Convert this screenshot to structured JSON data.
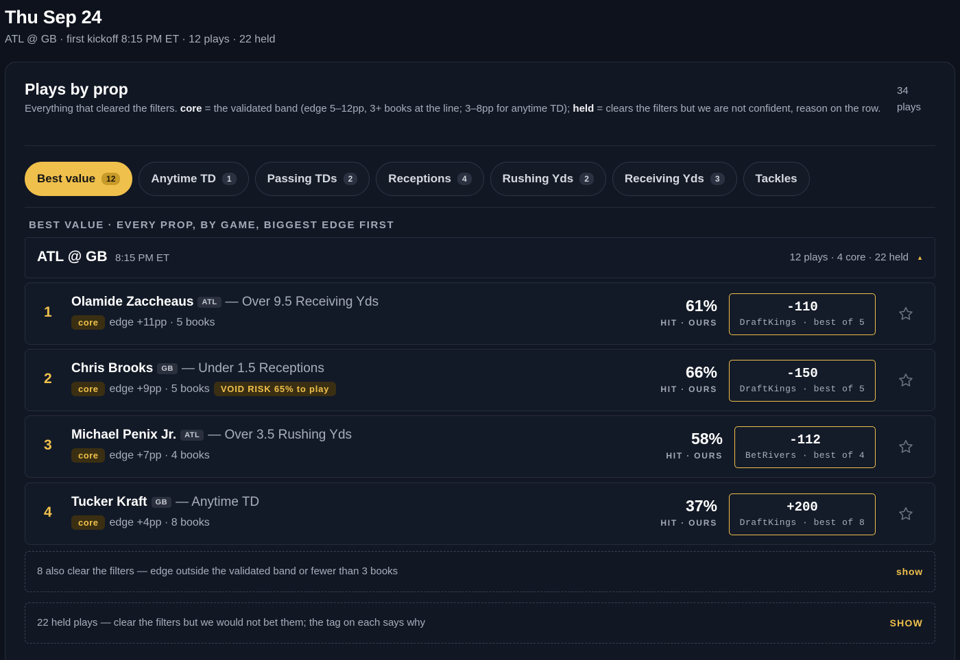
{
  "header": {
    "title": "Thu Sep 24",
    "subtitle": "ATL @ GB · first kickoff 8:15 PM ET · 12 plays · 22 held"
  },
  "card": {
    "title": "Plays by prop",
    "desc_pre": "Everything that cleared the filters. ",
    "desc_core": "core",
    "desc_mid": " = the validated band (edge 5–12pp, 3+ books at the line; 3–8pp for anytime TD); ",
    "desc_held": "held",
    "desc_post": " = clears the filters but we are not confident, reason on the row.",
    "plays_count": "34",
    "plays_label": "plays"
  },
  "tabs": [
    {
      "label": "Best value",
      "count": "12"
    },
    {
      "label": "Anytime TD",
      "count": "1"
    },
    {
      "label": "Passing TDs",
      "count": "2"
    },
    {
      "label": "Receptions",
      "count": "4"
    },
    {
      "label": "Rushing Yds",
      "count": "2"
    },
    {
      "label": "Receiving Yds",
      "count": "3"
    },
    {
      "label": "Tackles"
    }
  ],
  "section_label": "BEST VALUE · EVERY PROP, BY GAME, BIGGEST EDGE FIRST",
  "game": {
    "name": "ATL @ GB",
    "time": "8:15 PM ET",
    "summary": "12 plays · 4 core · 22 held",
    "caret": "▲"
  },
  "plays": [
    {
      "rank": "1",
      "player": "Olamide Zaccheaus",
      "team": "ATL",
      "market": "— Over 9.5 Receiving Yds",
      "badge": "core",
      "edge": "edge +11pp · 5 books",
      "hit": "61%",
      "hit_label": "HIT · OURS",
      "price": "-110",
      "book": "DraftKings · best of 5"
    },
    {
      "rank": "2",
      "player": "Chris Brooks",
      "team": "GB",
      "market": "— Under 1.5 Receptions",
      "badge": "core",
      "edge": "edge +9pp · 5 books",
      "void": "VOID RISK 65% to play",
      "hit": "66%",
      "hit_label": "HIT · OURS",
      "price": "-150",
      "book": "DraftKings · best of 5"
    },
    {
      "rank": "3",
      "player": "Michael Penix Jr.",
      "team": "ATL",
      "market": "— Over 3.5 Rushing Yds",
      "badge": "core",
      "edge": "edge +7pp · 4 books",
      "hit": "58%",
      "hit_label": "HIT · OURS",
      "price": "-112",
      "book": "BetRivers · best of 4"
    },
    {
      "rank": "4",
      "player": "Tucker Kraft",
      "team": "GB",
      "market": "— Anytime TD",
      "badge": "core",
      "edge": "edge +4pp · 8 books",
      "hit": "37%",
      "hit_label": "HIT · OURS",
      "price": "+200",
      "book": "DraftKings · best of 8"
    }
  ],
  "also_clear": {
    "text": "8 also clear the filters — edge outside the validated band or fewer than 3 books",
    "action": "show"
  },
  "held": {
    "text": "22 held plays — clear the filters but we would not bet them; the tag on each says why",
    "action": "SHOW"
  },
  "colors": {
    "accent": "#efc04b",
    "background": "#0d121c",
    "card": "#111723"
  },
  "icons": [
    "star-icon",
    "caret-up-icon"
  ]
}
